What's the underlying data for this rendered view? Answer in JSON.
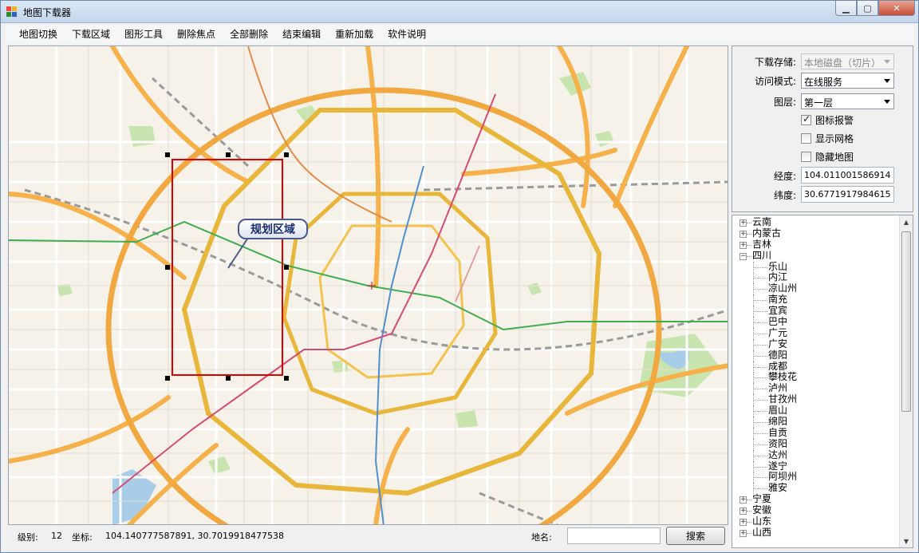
{
  "window": {
    "title": "地图下载器"
  },
  "menu": [
    "地图切换",
    "下载区域",
    "图形工具",
    "删除焦点",
    "全部删除",
    "结束编辑",
    "重新加载",
    "软件说明"
  ],
  "map": {
    "callout": "规划区域"
  },
  "status": {
    "level_label": "级别:",
    "level_value": "12",
    "coord_label": "坐标:",
    "coord_value": "104.140777587891, 30.7019918477538",
    "place_label": "地名:",
    "search_placeholder": "",
    "search_button": "搜索"
  },
  "panel": {
    "storage_label": "下载存储:",
    "storage_value": "本地磁盘（切片）",
    "access_label": "访问模式:",
    "access_value": "在线服务",
    "layer_label": "图层:",
    "layer_value": "第一层",
    "chk_alarm": {
      "label": "图标报警",
      "checked": true
    },
    "chk_grid": {
      "label": "显示网格",
      "checked": false
    },
    "chk_hide": {
      "label": "隐藏地图",
      "checked": false
    },
    "lon_label": "经度:",
    "lon_value": "104.011001586914",
    "lat_label": "纬度:",
    "lat_value": "30.6771917984615"
  },
  "tree": {
    "before": [
      "云南",
      "内蒙古",
      "吉林"
    ],
    "expanded": {
      "name": "四川",
      "children": [
        "乐山",
        "内江",
        "凉山州",
        "南充",
        "宜宾",
        "巴中",
        "广元",
        "广安",
        "德阳",
        "成都",
        "攀枝花",
        "泸州",
        "甘孜州",
        "眉山",
        "绵阳",
        "自贡",
        "资阳",
        "达州",
        "遂宁",
        "阿坝州",
        "雅安"
      ]
    },
    "after": [
      "宁夏",
      "安徽",
      "山东",
      "山西"
    ]
  }
}
